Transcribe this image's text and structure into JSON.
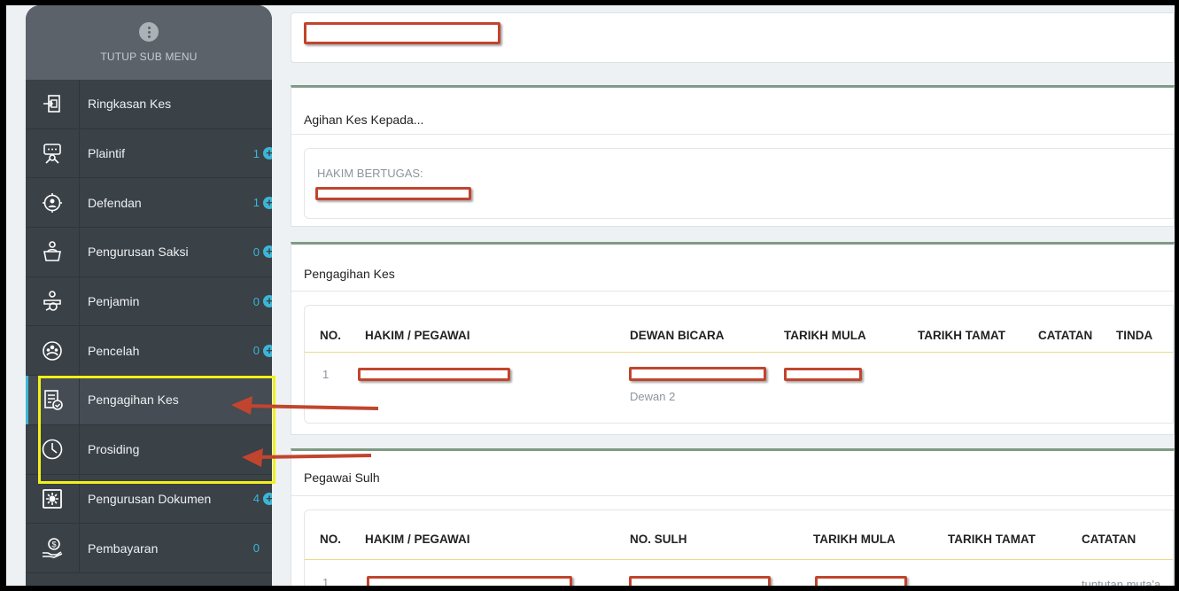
{
  "sidebar": {
    "header_label": "TUTUP SUB MENU",
    "items": [
      {
        "label": "Ringkasan Kes",
        "count": "",
        "plus": false,
        "icon": "case-summary-icon"
      },
      {
        "label": "Plaintif",
        "count": "1",
        "plus": true,
        "icon": "plaintiff-icon"
      },
      {
        "label": "Defendan",
        "count": "1",
        "plus": true,
        "icon": "defendant-icon"
      },
      {
        "label": "Pengurusan Saksi",
        "count": "0",
        "plus": true,
        "icon": "witness-icon"
      },
      {
        "label": "Penjamin",
        "count": "0",
        "plus": true,
        "icon": "guarantor-icon"
      },
      {
        "label": "Pencelah",
        "count": "0",
        "plus": true,
        "icon": "intervener-icon"
      },
      {
        "label": "Pengagihan Kes",
        "count": "",
        "plus": false,
        "icon": "case-assign-icon"
      },
      {
        "label": "Prosiding",
        "count": "",
        "plus": false,
        "icon": "clock-icon"
      },
      {
        "label": "Pengurusan Dokumen",
        "count": "4",
        "plus": true,
        "icon": "document-gear-icon"
      },
      {
        "label": "Pembayaran",
        "count": "0",
        "plus": false,
        "icon": "payment-icon"
      }
    ]
  },
  "agihan": {
    "title": "Agihan Kes Kepada...",
    "hakim_label": "HAKIM BERTUGAS:"
  },
  "pengagihan": {
    "title": "Pengagihan Kes",
    "columns": [
      "NO.",
      "HAKIM / PEGAWAI",
      "DEWAN BICARA",
      "TARIKH MULA",
      "TARIKH TAMAT",
      "CATATAN",
      "TINDA"
    ],
    "row": {
      "no": "1",
      "dewan": "Dewan 2"
    }
  },
  "sulh": {
    "title": "Pegawai Sulh",
    "columns": [
      "NO.",
      "HAKIM / PEGAWAI",
      "NO. SULH",
      "TARIKH MULA",
      "TARIKH TAMAT",
      "CATATAN"
    ],
    "row": {
      "no": "1",
      "catatan": "tuntutan muta'a"
    }
  },
  "colors": {
    "accent": "#3cb6d6",
    "sidebar": "#3a4147",
    "redaction": "#c1452e",
    "highlight": "#f3ef1b"
  }
}
